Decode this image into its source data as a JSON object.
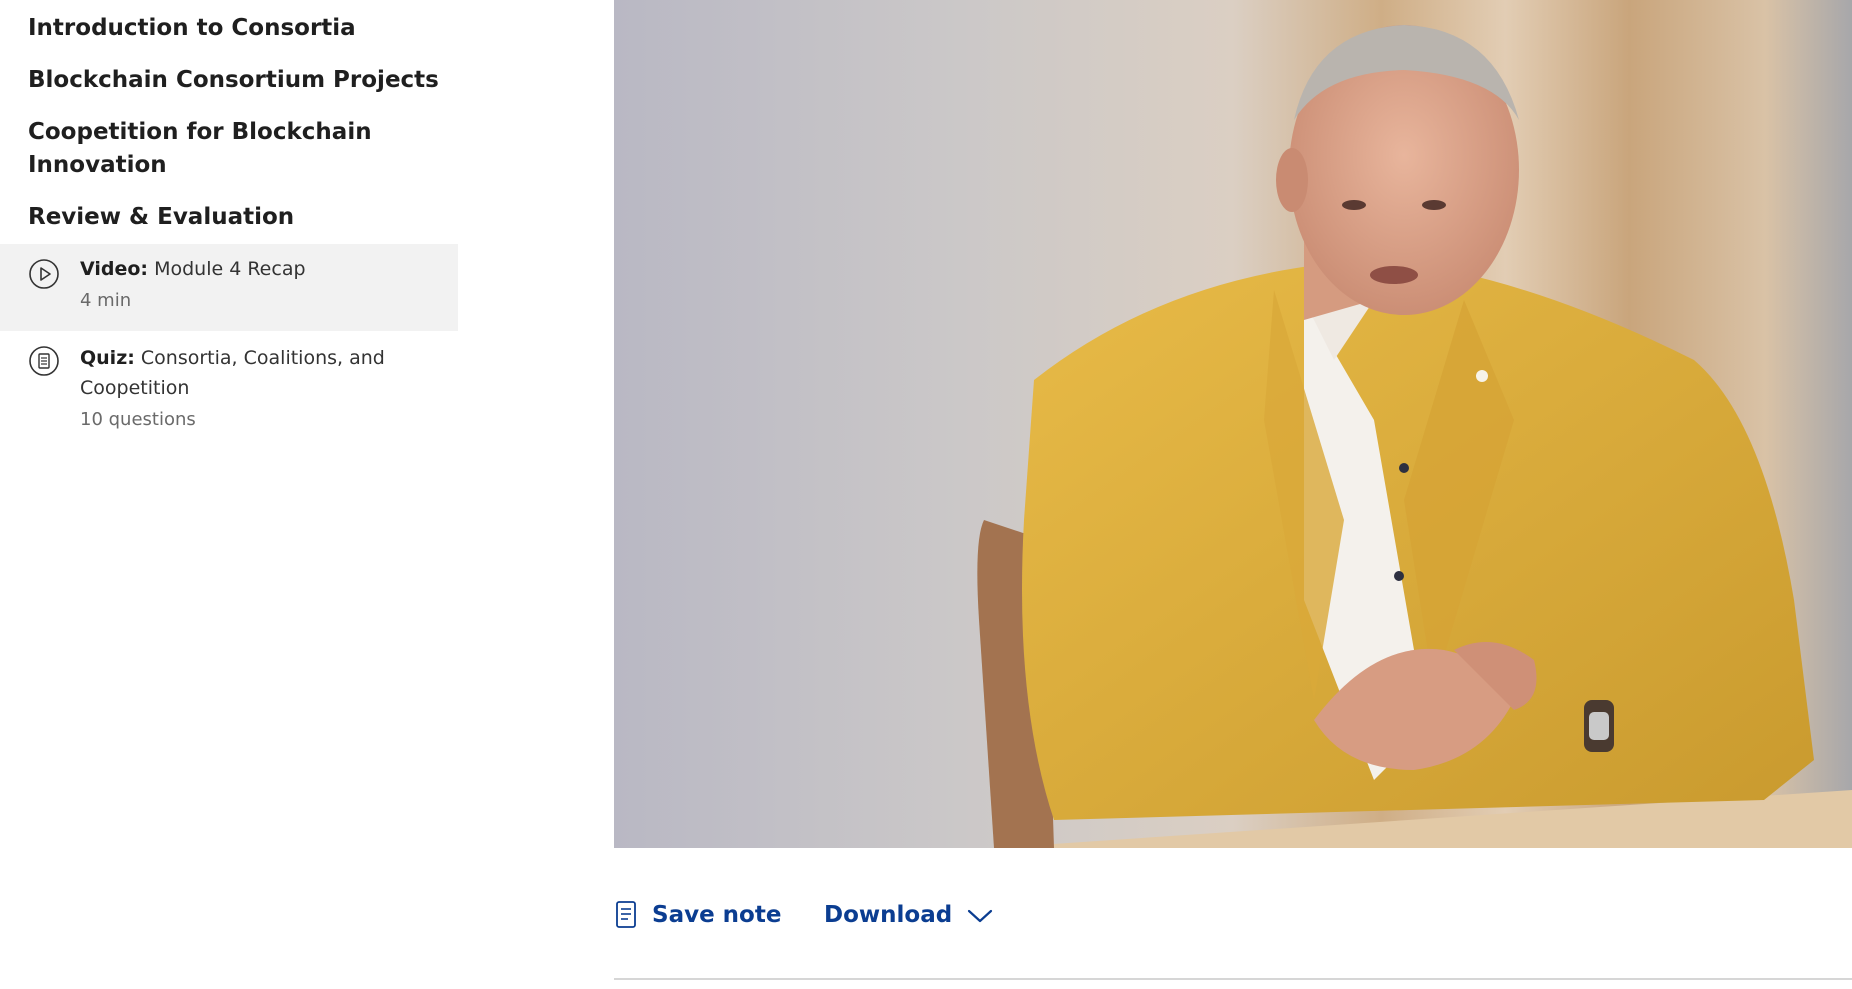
{
  "sidebar": {
    "sections": [
      "Introduction to Consortia",
      "Blockchain Consortium Projects",
      "Coopetition for Blockchain Innovation",
      "Review & Evaluation"
    ],
    "items": [
      {
        "type_label": "Video:",
        "title": "Module 4 Recap",
        "meta": "4 min",
        "icon": "play-circle-icon",
        "active": true
      },
      {
        "type_label": "Quiz:",
        "title": "Consortia, Coalitions, and Coopetition",
        "meta": "10 questions",
        "icon": "quiz-icon",
        "active": false
      }
    ]
  },
  "actions": {
    "save_note_label": "Save note",
    "download_label": "Download"
  },
  "colors": {
    "link": "#0b3d91",
    "active_row": "#f2f2f2",
    "jacket": "#e2b23e"
  }
}
